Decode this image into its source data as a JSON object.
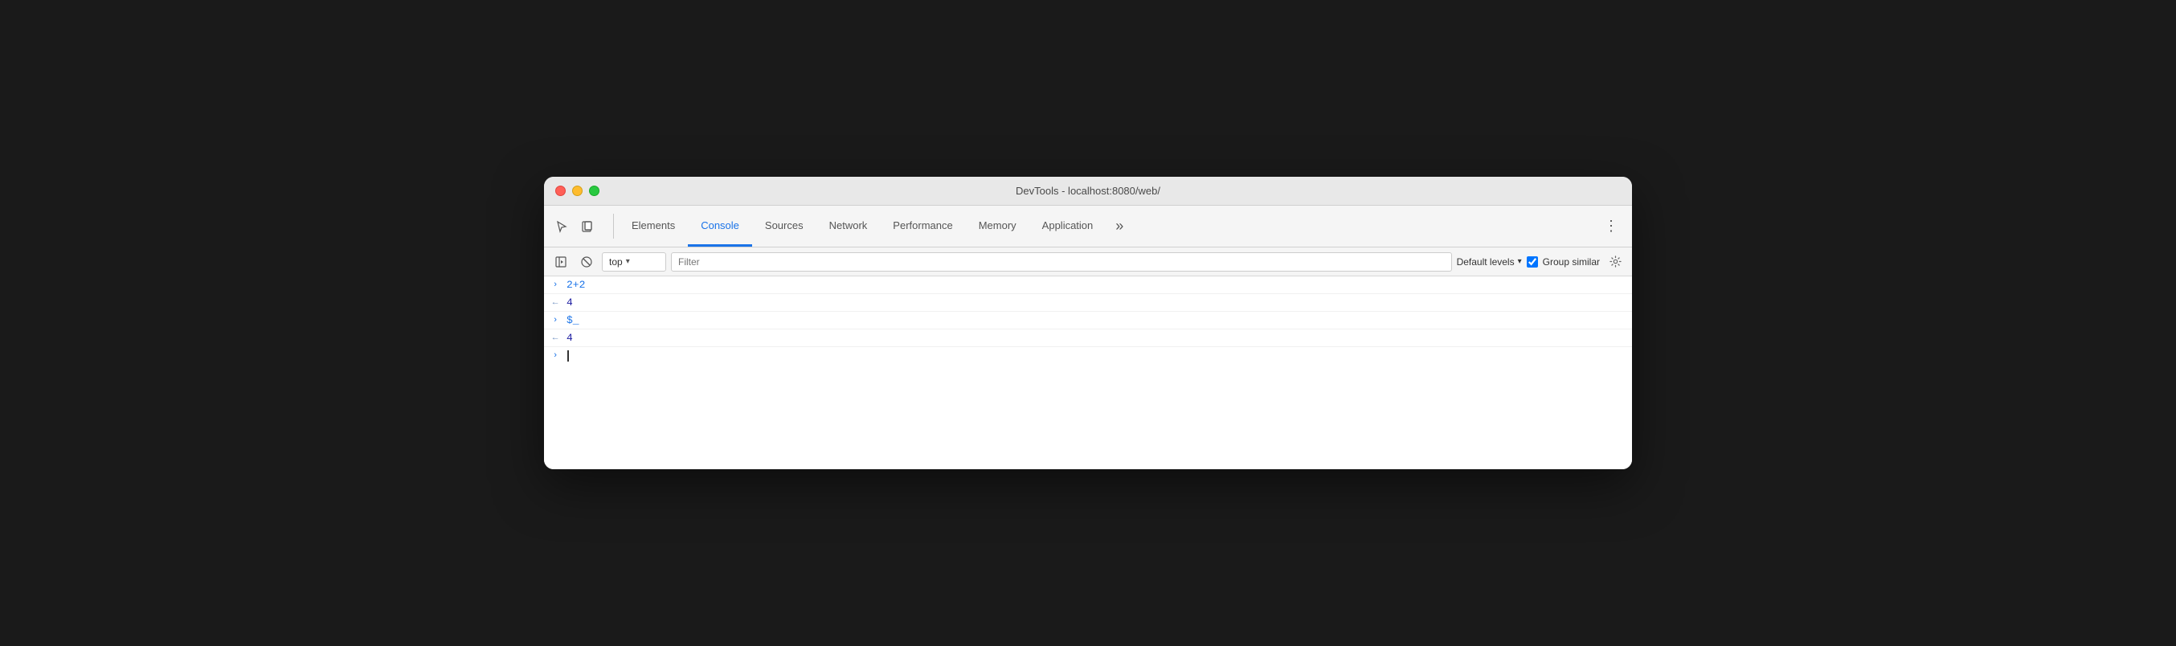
{
  "window": {
    "title": "DevTools - localhost:8080/web/"
  },
  "traffic_lights": {
    "close_label": "close",
    "minimize_label": "minimize",
    "maximize_label": "maximize"
  },
  "tabs": [
    {
      "id": "elements",
      "label": "Elements",
      "active": false
    },
    {
      "id": "console",
      "label": "Console",
      "active": true
    },
    {
      "id": "sources",
      "label": "Sources",
      "active": false
    },
    {
      "id": "network",
      "label": "Network",
      "active": false
    },
    {
      "id": "performance",
      "label": "Performance",
      "active": false
    },
    {
      "id": "memory",
      "label": "Memory",
      "active": false
    },
    {
      "id": "application",
      "label": "Application",
      "active": false
    }
  ],
  "tab_more_label": "»",
  "three_dots_label": "⋮",
  "toolbar": {
    "context_value": "top",
    "context_arrow": "▾",
    "filter_placeholder": "Filter",
    "levels_label": "Default levels",
    "levels_arrow": "▾",
    "group_similar_label": "Group similar",
    "group_similar_checked": true
  },
  "console_rows": [
    {
      "id": "row1",
      "arrow": ">",
      "arrow_color": "blue",
      "content": "2+2",
      "content_color": "blue"
    },
    {
      "id": "row2",
      "arrow": "←",
      "arrow_color": "gray-blue",
      "content": "4",
      "content_color": "dark-blue"
    },
    {
      "id": "row3",
      "arrow": ">",
      "arrow_color": "blue",
      "content": "$_",
      "content_color": "blue"
    },
    {
      "id": "row4",
      "arrow": "←",
      "arrow_color": "gray-blue",
      "content": "4",
      "content_color": "dark-blue"
    }
  ],
  "input_row": {
    "arrow": ">"
  }
}
